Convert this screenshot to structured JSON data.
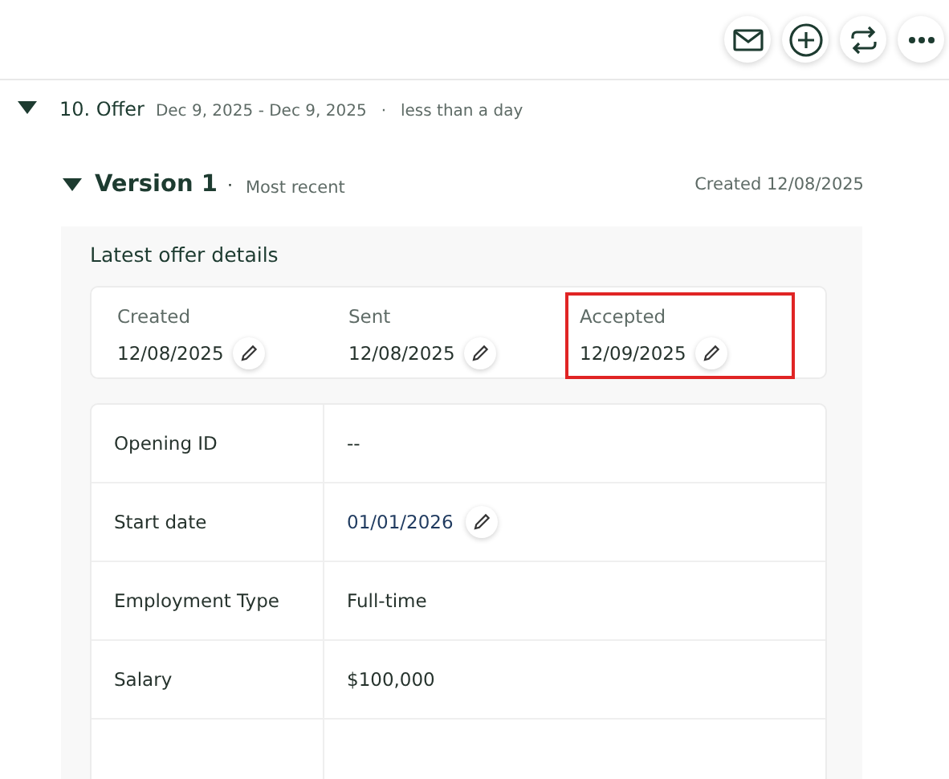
{
  "toolbar": [
    {
      "kind": "mail"
    },
    {
      "kind": "add"
    },
    {
      "kind": "sync"
    },
    {
      "kind": "more"
    }
  ],
  "stage": {
    "expanded": true,
    "title": "10. Offer",
    "dates": "Dec 9, 2025 - Dec 9, 2025",
    "separator": "·",
    "duration": "less than a day"
  },
  "version": {
    "expanded": true,
    "title": "Version 1",
    "separator": "·",
    "tag": "Most recent",
    "created": "Created 12/08/2025"
  },
  "details": {
    "title": "Latest offer details",
    "dates": [
      {
        "label": "Created",
        "value": "12/08/2025",
        "highlighted": false
      },
      {
        "label": "Sent",
        "value": "12/08/2025",
        "highlighted": false
      },
      {
        "label": "Accepted",
        "value": "12/09/2025",
        "highlighted": true
      }
    ],
    "rows": [
      {
        "label": "Opening ID",
        "value": "--",
        "editable": false
      },
      {
        "label": "Start date",
        "value": "01/01/2026",
        "editable": true
      },
      {
        "label": "Employment Type",
        "value": "Full-time",
        "editable": false
      },
      {
        "label": "Salary",
        "value": "$100,000",
        "editable": false
      }
    ]
  }
}
